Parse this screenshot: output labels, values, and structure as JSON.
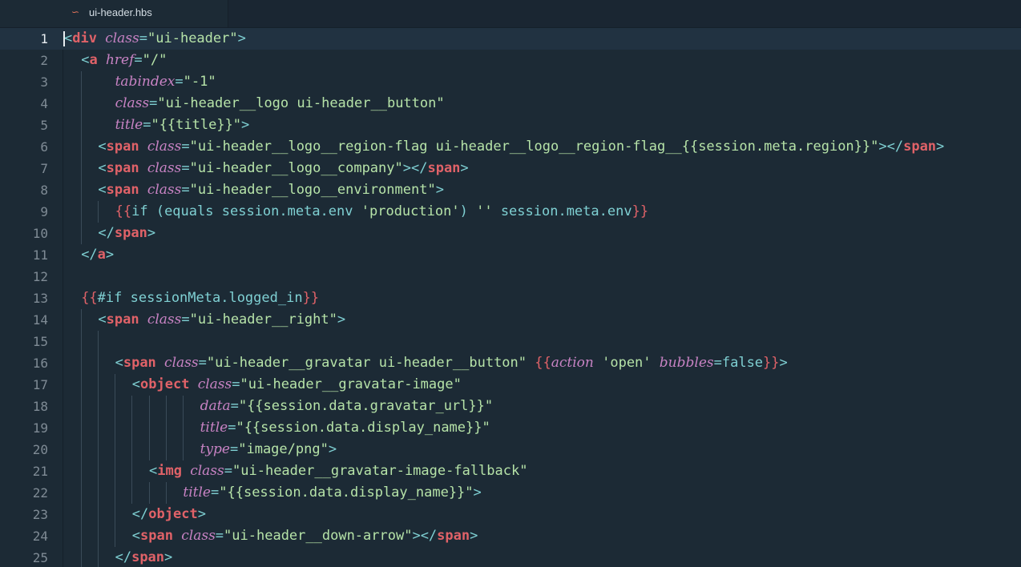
{
  "tab": {
    "icon": "hbs-file-icon",
    "icon_glyph": "∽",
    "label": "ui-header.hbs"
  },
  "lines": [
    {
      "n": "1",
      "indent": 0,
      "guides": [],
      "tokens": [
        [
          "pn",
          "<"
        ],
        [
          "tg",
          "div"
        ],
        [
          "t",
          " "
        ],
        [
          "at",
          "class"
        ],
        [
          "pn",
          "="
        ],
        [
          "st",
          "\"ui-header\""
        ],
        [
          "pn",
          ">"
        ]
      ]
    },
    {
      "n": "2",
      "indent": 1,
      "guides": [],
      "tokens": [
        [
          "pn",
          "<"
        ],
        [
          "tg",
          "a"
        ],
        [
          "t",
          " "
        ],
        [
          "at",
          "href"
        ],
        [
          "pn",
          "="
        ],
        [
          "st",
          "\"/\""
        ]
      ]
    },
    {
      "n": "3",
      "indent": 3,
      "guides": [
        1
      ],
      "tokens": [
        [
          "at",
          "tabindex"
        ],
        [
          "pn",
          "="
        ],
        [
          "st",
          "\"-1\""
        ]
      ]
    },
    {
      "n": "4",
      "indent": 3,
      "guides": [
        1
      ],
      "tokens": [
        [
          "at",
          "class"
        ],
        [
          "pn",
          "="
        ],
        [
          "st",
          "\"ui-header__logo ui-header__button\""
        ]
      ]
    },
    {
      "n": "5",
      "indent": 3,
      "guides": [
        1
      ],
      "tokens": [
        [
          "at",
          "title"
        ],
        [
          "pn",
          "="
        ],
        [
          "st",
          "\"{{title}}\""
        ],
        [
          "pn",
          ">"
        ]
      ]
    },
    {
      "n": "6",
      "indent": 2,
      "guides": [
        1
      ],
      "tokens": [
        [
          "pn",
          "<"
        ],
        [
          "tg",
          "span"
        ],
        [
          "t",
          " "
        ],
        [
          "at",
          "class"
        ],
        [
          "pn",
          "="
        ],
        [
          "st",
          "\"ui-header__logo__region-flag ui-header__logo__region-flag__{{session.meta.region}}\""
        ],
        [
          "pn",
          "></"
        ],
        [
          "tg",
          "span"
        ],
        [
          "pn",
          ">"
        ]
      ]
    },
    {
      "n": "7",
      "indent": 2,
      "guides": [
        1
      ],
      "tokens": [
        [
          "pn",
          "<"
        ],
        [
          "tg",
          "span"
        ],
        [
          "t",
          " "
        ],
        [
          "at",
          "class"
        ],
        [
          "pn",
          "="
        ],
        [
          "st",
          "\"ui-header__logo__company\""
        ],
        [
          "pn",
          "></"
        ],
        [
          "tg",
          "span"
        ],
        [
          "pn",
          ">"
        ]
      ]
    },
    {
      "n": "8",
      "indent": 2,
      "guides": [
        1
      ],
      "tokens": [
        [
          "pn",
          "<"
        ],
        [
          "tg",
          "span"
        ],
        [
          "t",
          " "
        ],
        [
          "at",
          "class"
        ],
        [
          "pn",
          "="
        ],
        [
          "st",
          "\"ui-header__logo__environment\""
        ],
        [
          "pn",
          ">"
        ]
      ]
    },
    {
      "n": "9",
      "indent": 3,
      "guides": [
        1,
        2
      ],
      "tokens": [
        [
          "hb",
          "{{"
        ],
        [
          "hk",
          "if"
        ],
        [
          "t",
          " "
        ],
        [
          "pn",
          "("
        ],
        [
          "hk",
          "equals"
        ],
        [
          "t",
          " "
        ],
        [
          "hv",
          "session.meta.env"
        ],
        [
          "t",
          " "
        ],
        [
          "st",
          "'production'"
        ],
        [
          "pn",
          ")"
        ],
        [
          "t",
          " "
        ],
        [
          "st",
          "''"
        ],
        [
          "t",
          " "
        ],
        [
          "hv",
          "session.meta.env"
        ],
        [
          "hb",
          "}}"
        ]
      ]
    },
    {
      "n": "10",
      "indent": 2,
      "guides": [
        1
      ],
      "tokens": [
        [
          "pn",
          "</"
        ],
        [
          "tg",
          "span"
        ],
        [
          "pn",
          ">"
        ]
      ]
    },
    {
      "n": "11",
      "indent": 1,
      "guides": [],
      "tokens": [
        [
          "pn",
          "</"
        ],
        [
          "tg",
          "a"
        ],
        [
          "pn",
          ">"
        ]
      ]
    },
    {
      "n": "12",
      "indent": 0,
      "guides": [],
      "tokens": []
    },
    {
      "n": "13",
      "indent": 1,
      "guides": [],
      "tokens": [
        [
          "hb",
          "{{"
        ],
        [
          "hk",
          "#if"
        ],
        [
          "t",
          " "
        ],
        [
          "hv",
          "sessionMeta.logged_in"
        ],
        [
          "hb",
          "}}"
        ]
      ]
    },
    {
      "n": "14",
      "indent": 2,
      "guides": [
        1
      ],
      "tokens": [
        [
          "pn",
          "<"
        ],
        [
          "tg",
          "span"
        ],
        [
          "t",
          " "
        ],
        [
          "at",
          "class"
        ],
        [
          "pn",
          "="
        ],
        [
          "st",
          "\"ui-header__right\""
        ],
        [
          "pn",
          ">"
        ]
      ]
    },
    {
      "n": "15",
      "indent": 0,
      "guides": [
        1,
        2
      ],
      "tokens": []
    },
    {
      "n": "16",
      "indent": 3,
      "guides": [
        1,
        2
      ],
      "tokens": [
        [
          "pn",
          "<"
        ],
        [
          "tg",
          "span"
        ],
        [
          "t",
          " "
        ],
        [
          "at",
          "class"
        ],
        [
          "pn",
          "="
        ],
        [
          "st",
          "\"ui-header__gravatar ui-header__button\""
        ],
        [
          "t",
          " "
        ],
        [
          "hb",
          "{{"
        ],
        [
          "at",
          "action"
        ],
        [
          "t",
          " "
        ],
        [
          "st",
          "'open'"
        ],
        [
          "t",
          " "
        ],
        [
          "at",
          "bubbles"
        ],
        [
          "pn",
          "="
        ],
        [
          "hv",
          "false"
        ],
        [
          "hb",
          "}}"
        ],
        [
          "pn",
          ">"
        ]
      ]
    },
    {
      "n": "17",
      "indent": 4,
      "guides": [
        1,
        2,
        3
      ],
      "tokens": [
        [
          "pn",
          "<"
        ],
        [
          "tg",
          "object"
        ],
        [
          "t",
          " "
        ],
        [
          "at",
          "class"
        ],
        [
          "pn",
          "="
        ],
        [
          "st",
          "\"ui-header__gravatar-image\""
        ]
      ]
    },
    {
      "n": "18",
      "indent": 8,
      "guides": [
        1,
        2,
        3,
        4,
        5,
        6,
        7
      ],
      "tokens": [
        [
          "at",
          "data"
        ],
        [
          "pn",
          "="
        ],
        [
          "st",
          "\"{{session.data.gravatar_url}}\""
        ]
      ]
    },
    {
      "n": "19",
      "indent": 8,
      "guides": [
        1,
        2,
        3,
        4,
        5,
        6,
        7
      ],
      "tokens": [
        [
          "at",
          "title"
        ],
        [
          "pn",
          "="
        ],
        [
          "st",
          "\"{{session.data.display_name}}\""
        ]
      ]
    },
    {
      "n": "20",
      "indent": 8,
      "guides": [
        1,
        2,
        3,
        4,
        5,
        6,
        7
      ],
      "tokens": [
        [
          "at",
          "type"
        ],
        [
          "pn",
          "="
        ],
        [
          "st",
          "\"image/png\""
        ],
        [
          "pn",
          ">"
        ]
      ]
    },
    {
      "n": "21",
      "indent": 5,
      "guides": [
        1,
        2,
        3,
        4
      ],
      "tokens": [
        [
          "pn",
          "<"
        ],
        [
          "tg",
          "img"
        ],
        [
          "t",
          " "
        ],
        [
          "at",
          "class"
        ],
        [
          "pn",
          "="
        ],
        [
          "st",
          "\"ui-header__gravatar-image-fallback\""
        ]
      ]
    },
    {
      "n": "22",
      "indent": 7,
      "guides": [
        1,
        2,
        3,
        4,
        5,
        6
      ],
      "tokens": [
        [
          "at",
          "title"
        ],
        [
          "pn",
          "="
        ],
        [
          "st",
          "\"{{session.data.display_name}}\""
        ],
        [
          "pn",
          ">"
        ]
      ]
    },
    {
      "n": "23",
      "indent": 4,
      "guides": [
        1,
        2,
        3
      ],
      "tokens": [
        [
          "pn",
          "</"
        ],
        [
          "tg",
          "object"
        ],
        [
          "pn",
          ">"
        ]
      ]
    },
    {
      "n": "24",
      "indent": 4,
      "guides": [
        1,
        2,
        3
      ],
      "tokens": [
        [
          "pn",
          "<"
        ],
        [
          "tg",
          "span"
        ],
        [
          "t",
          " "
        ],
        [
          "at",
          "class"
        ],
        [
          "pn",
          "="
        ],
        [
          "st",
          "\"ui-header__down-arrow\""
        ],
        [
          "pn",
          "></"
        ],
        [
          "tg",
          "span"
        ],
        [
          "pn",
          ">"
        ]
      ]
    },
    {
      "n": "25",
      "indent": 3,
      "guides": [
        1,
        2
      ],
      "tokens": [
        [
          "pn",
          "</"
        ],
        [
          "tg",
          "span"
        ],
        [
          "pn",
          ">"
        ]
      ]
    }
  ]
}
